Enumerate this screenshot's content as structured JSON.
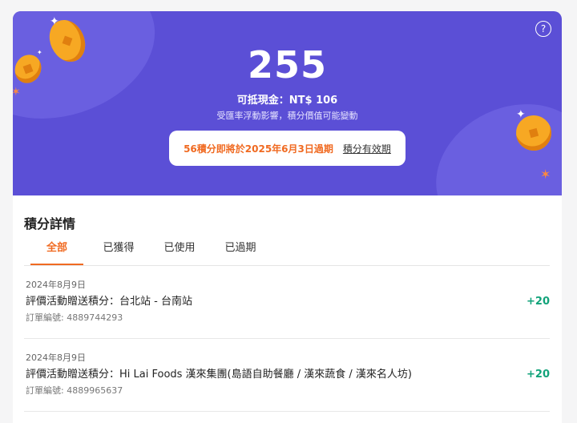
{
  "summary": {
    "points": "255",
    "cash_value": "可抵現金：NT$ 106",
    "fluctuation_note": "受匯率浮動影響，積分價值可能變動",
    "expiry_warning": "56積分即將於2025年6月3日過期",
    "validity_link": "積分有效期",
    "help_icon": "?"
  },
  "details": {
    "title": "積分詳情",
    "tabs": [
      "全部",
      "已獲得",
      "已使用",
      "已過期"
    ],
    "active_tab": "全部",
    "entries": [
      {
        "date": "2024年8月9日",
        "description": "評價活動贈送積分：台北站 - 台南站",
        "order": "訂單編號: 4889744293",
        "points": "+20"
      },
      {
        "date": "2024年8月9日",
        "description": "評價活動贈送積分：Hi Lai Foods 漢來集團(島語自助餐廳 / 漢來蔬食 / 漢來名人坊)",
        "order": "訂單編號: 4889965637",
        "points": "+20"
      }
    ]
  },
  "colors": {
    "hero_bg": "#5b4fd6",
    "accent_orange": "#f06a21",
    "points_green": "#12a37a"
  }
}
